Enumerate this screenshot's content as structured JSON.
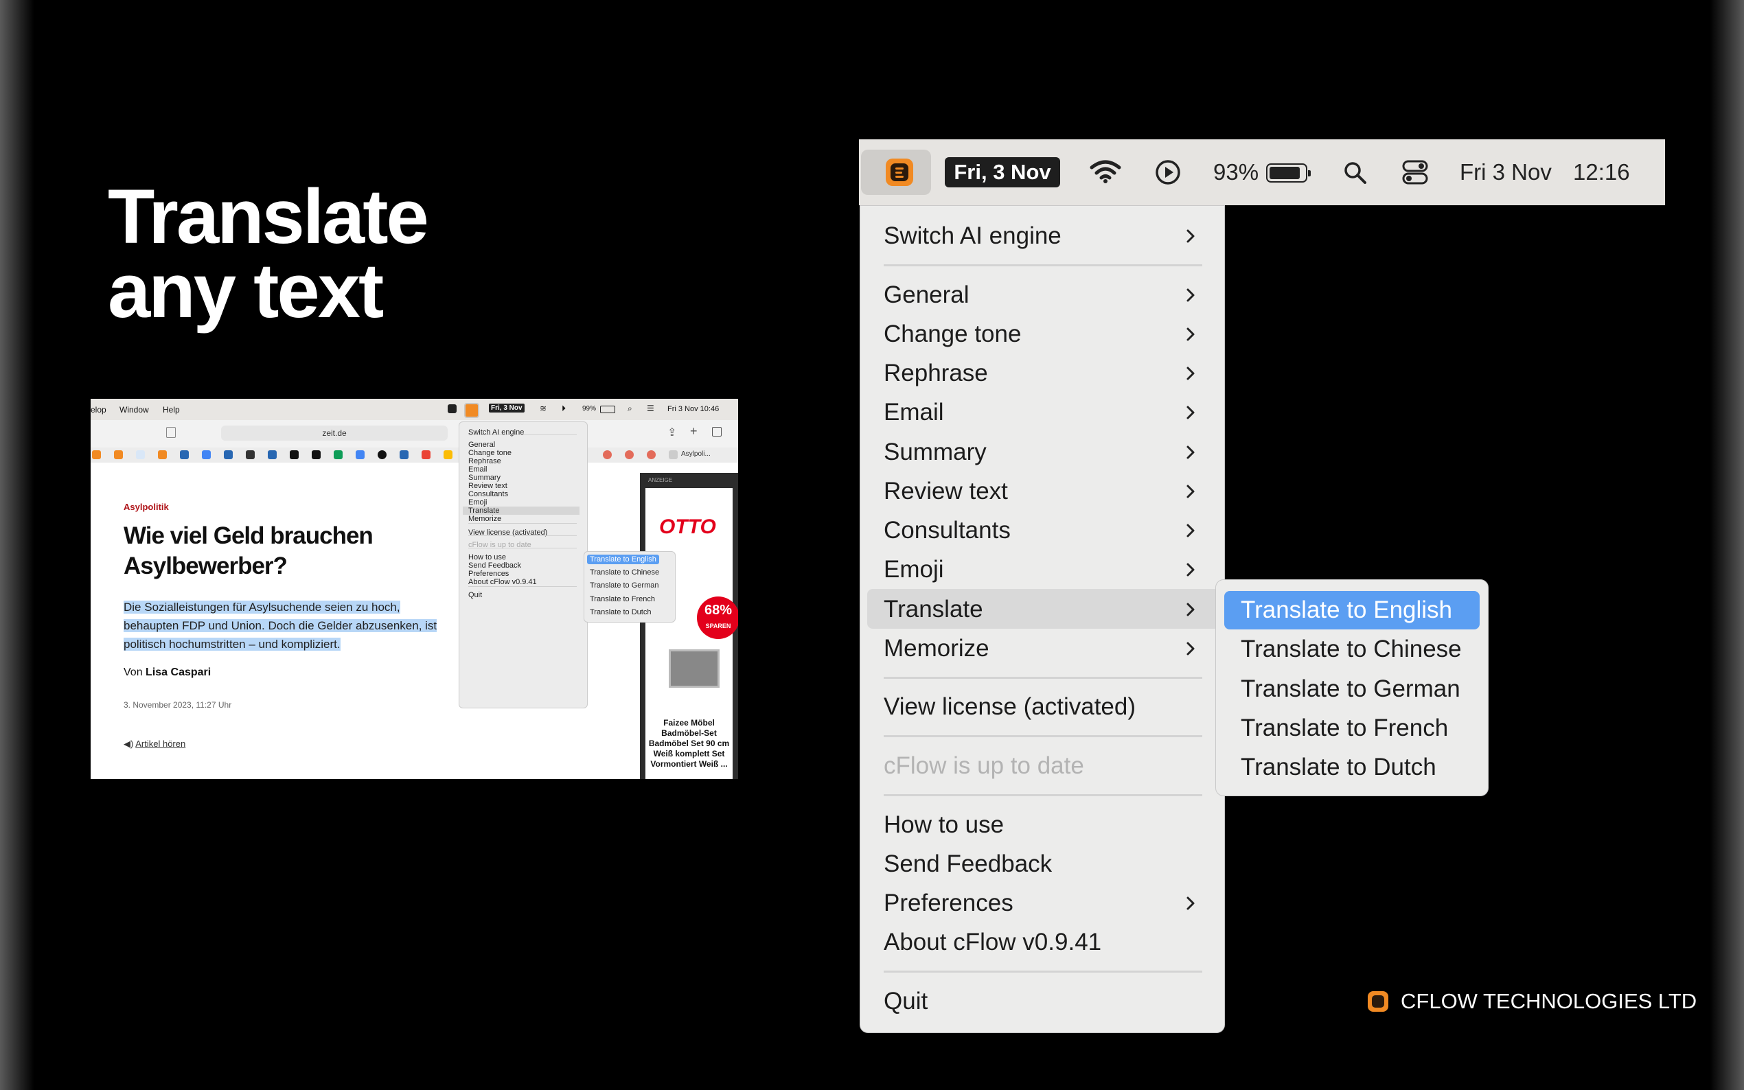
{
  "headline": {
    "line1": "Translate",
    "line2": "any text"
  },
  "mini": {
    "menubar": {
      "item_develop": "elop",
      "item_window": "Window",
      "item_help": "Help",
      "date_badge": "Fri, 3 Nov",
      "battery": "99%",
      "clock": "Fri 3 Nov  10:46"
    },
    "address": "zeit.de",
    "tab_label": "Asylpoli...",
    "article": {
      "kicker": "Asylpolitik",
      "title_line1": "Wie viel Geld brauchen",
      "title_line2": "Asylbewerber?",
      "lede_line1": "Die Sozialleistungen für Asylsuchende seien zu hoch,",
      "lede_line2": "behaupten FDP und Union. Doch die Gelder abzusenken, ist",
      "lede_line3": "politisch hochumstritten – und kompliziert.",
      "author_prefix": "Von",
      "author": "Lisa Caspari",
      "date": "3. November 2023, 11:27 Uhr",
      "listen": "Artikel hören"
    },
    "ad": {
      "label": "ANZEIGE",
      "brand": "OTTO",
      "badge_pct": "68%",
      "badge_text": "SPAREN",
      "product": "Faizee Möbel Badmöbel-Set Badmöbel Set 90 cm Weiß komplett Set Vormontiert Weiß ..."
    },
    "menu": [
      "Switch AI engine",
      "General",
      "Change tone",
      "Rephrase",
      "Email",
      "Summary",
      "Review text",
      "Consultants",
      "Emoji",
      "Translate",
      "Memorize",
      "View license (activated)",
      "cFlow is up to date",
      "How to use",
      "Send Feedback",
      "Preferences",
      "About cFlow v0.9.41",
      "Quit"
    ],
    "submenu": [
      "Translate to English",
      "Translate to Chinese",
      "Translate to German",
      "Translate to French",
      "Translate to Dutch"
    ]
  },
  "menubar": {
    "date_badge": "Fri, 3 Nov",
    "battery": "93%",
    "clock_date": "Fri 3 Nov",
    "clock_time": "12:16"
  },
  "menu": {
    "switch_ai": "Switch AI engine",
    "general": "General",
    "change_tone": "Change tone",
    "rephrase": "Rephrase",
    "email": "Email",
    "summary": "Summary",
    "review_text": "Review text",
    "consultants": "Consultants",
    "emoji": "Emoji",
    "translate": "Translate",
    "memorize": "Memorize",
    "view_license": "View license (activated)",
    "up_to_date": "cFlow is up to date",
    "how_to_use": "How to use",
    "send_feedback": "Send Feedback",
    "preferences": "Preferences",
    "about": "About cFlow v0.9.41",
    "quit": "Quit"
  },
  "submenu": {
    "english": "Translate to English",
    "chinese": "Translate to Chinese",
    "german": "Translate to German",
    "french": "Translate to French",
    "dutch": "Translate to Dutch"
  },
  "footer": {
    "company": "CFLOW TECHNOLOGIES LTD"
  },
  "colors": {
    "accent": "#f18a23",
    "highlight": "#5b9ef2",
    "menu_bg": "#ececeb",
    "background": "#000000"
  }
}
